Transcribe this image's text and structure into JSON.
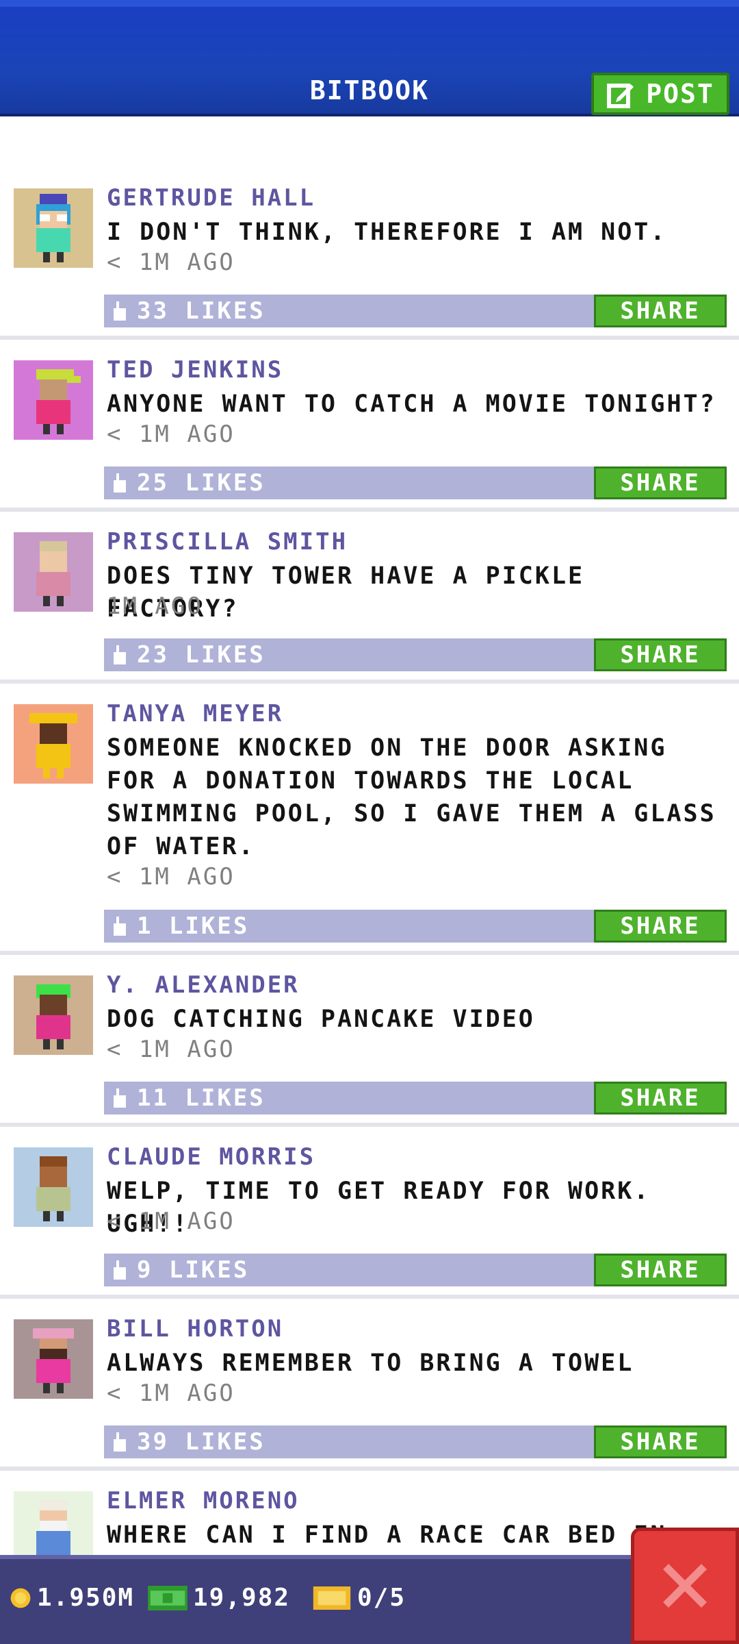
{
  "header": {
    "title": "BITBOOK",
    "post_label": "POST"
  },
  "posts": [
    {
      "name": "GERTRUDE HALL",
      "message": "I DON'T THINK, THEREFORE I AM NOT.",
      "time": "< 1M AGO",
      "likes": "33 LIKES",
      "share": "SHARE"
    },
    {
      "name": "TED JENKINS",
      "message": "ANYONE WANT TO CATCH A MOVIE TONIGHT?",
      "time": "< 1M AGO",
      "likes": "25 LIKES",
      "share": "SHARE"
    },
    {
      "name": "PRISCILLA SMITH",
      "message": "DOES TINY TOWER HAVE A PICKLE FACTORY?",
      "time": "1M AGO",
      "likes": "23 LIKES",
      "share": "SHARE"
    },
    {
      "name": "TANYA MEYER",
      "message": "SOMEONE KNOCKED ON THE DOOR ASKING FOR A DONATION TOWARDS THE LOCAL SWIMMING POOL, SO I GAVE THEM A GLASS OF WATER.",
      "time": "< 1M AGO",
      "likes": "1 LIKES",
      "share": "SHARE"
    },
    {
      "name": "Y. ALEXANDER",
      "message": "DOG CATCHING PANCAKE VIDEO",
      "time": "< 1M AGO",
      "likes": "11 LIKES",
      "share": "SHARE"
    },
    {
      "name": "CLAUDE MORRIS",
      "message": "WELP, TIME TO GET READY FOR WORK. UGH!!",
      "time": "< 1M AGO",
      "likes": "9 LIKES",
      "share": "SHARE"
    },
    {
      "name": "BILL HORTON",
      "message": "ALWAYS REMEMBER TO BRING A TOWEL",
      "time": "< 1M AGO",
      "likes": "39 LIKES",
      "share": "SHARE"
    },
    {
      "name": "ELMER MORENO",
      "message": "WHERE CAN I FIND A RACE CAR BED IN ADULT SIZES?",
      "time": "",
      "likes": "",
      "share": ""
    }
  ],
  "status": {
    "coins": "1.950M",
    "bux": "19,982",
    "tickets": "0/5"
  },
  "colors": {
    "header_blue": "#1b44b7",
    "accent_green": "#4fb22d",
    "name_purple": "#5e56a0",
    "like_bar": "#b0b2d8",
    "bottom_bar": "#3f3f79",
    "close_red": "#e33a3a"
  }
}
